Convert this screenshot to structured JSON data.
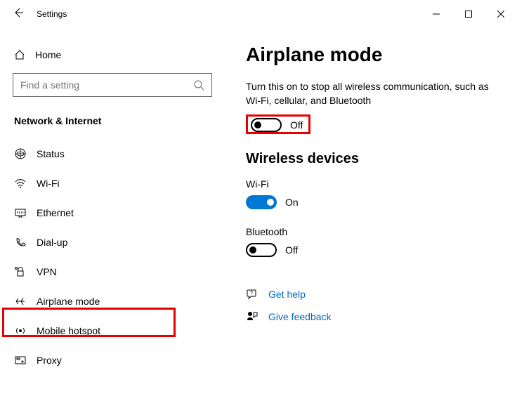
{
  "window": {
    "title": "Settings"
  },
  "sidebar": {
    "home": "Home",
    "search_placeholder": "Find a setting",
    "category": "Network & Internet",
    "items": [
      {
        "label": "Status"
      },
      {
        "label": "Wi-Fi"
      },
      {
        "label": "Ethernet"
      },
      {
        "label": "Dial-up"
      },
      {
        "label": "VPN"
      },
      {
        "label": "Airplane mode"
      },
      {
        "label": "Mobile hotspot"
      },
      {
        "label": "Proxy"
      }
    ]
  },
  "main": {
    "title": "Airplane mode",
    "description": "Turn this on to stop all wireless communication, such as Wi-Fi, cellular, and Bluetooth",
    "airplane_toggle": {
      "state": "Off"
    },
    "wireless_title": "Wireless devices",
    "wifi": {
      "label": "Wi-Fi",
      "state": "On"
    },
    "bluetooth": {
      "label": "Bluetooth",
      "state": "Off"
    },
    "help": "Get help",
    "feedback": "Give feedback"
  }
}
